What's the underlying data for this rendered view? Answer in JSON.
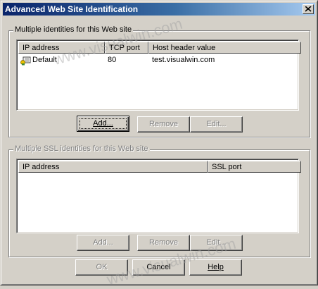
{
  "window": {
    "title": "Advanced Web Site Identification",
    "close_icon": "close-icon"
  },
  "group1": {
    "label": "Multiple identities for this Web site",
    "columns": [
      "IP address",
      "TCP port",
      "Host header value"
    ],
    "rows": [
      {
        "icon": "site-identity-icon",
        "ip": "Default",
        "port": "80",
        "host": "test.visualwin.com"
      }
    ],
    "buttons": {
      "add": "Add...",
      "remove": "Remove",
      "edit": "Edit..."
    }
  },
  "group2": {
    "label": "Multiple SSL identities for this Web site",
    "columns": [
      "IP address",
      "SSL port"
    ],
    "rows": [],
    "buttons": {
      "add": "Add...",
      "remove": "Remove",
      "edit": "Edit..."
    }
  },
  "footer": {
    "ok": "OK",
    "cancel": "Cancel",
    "help": "Help"
  },
  "watermark": "www.visualwin.com"
}
